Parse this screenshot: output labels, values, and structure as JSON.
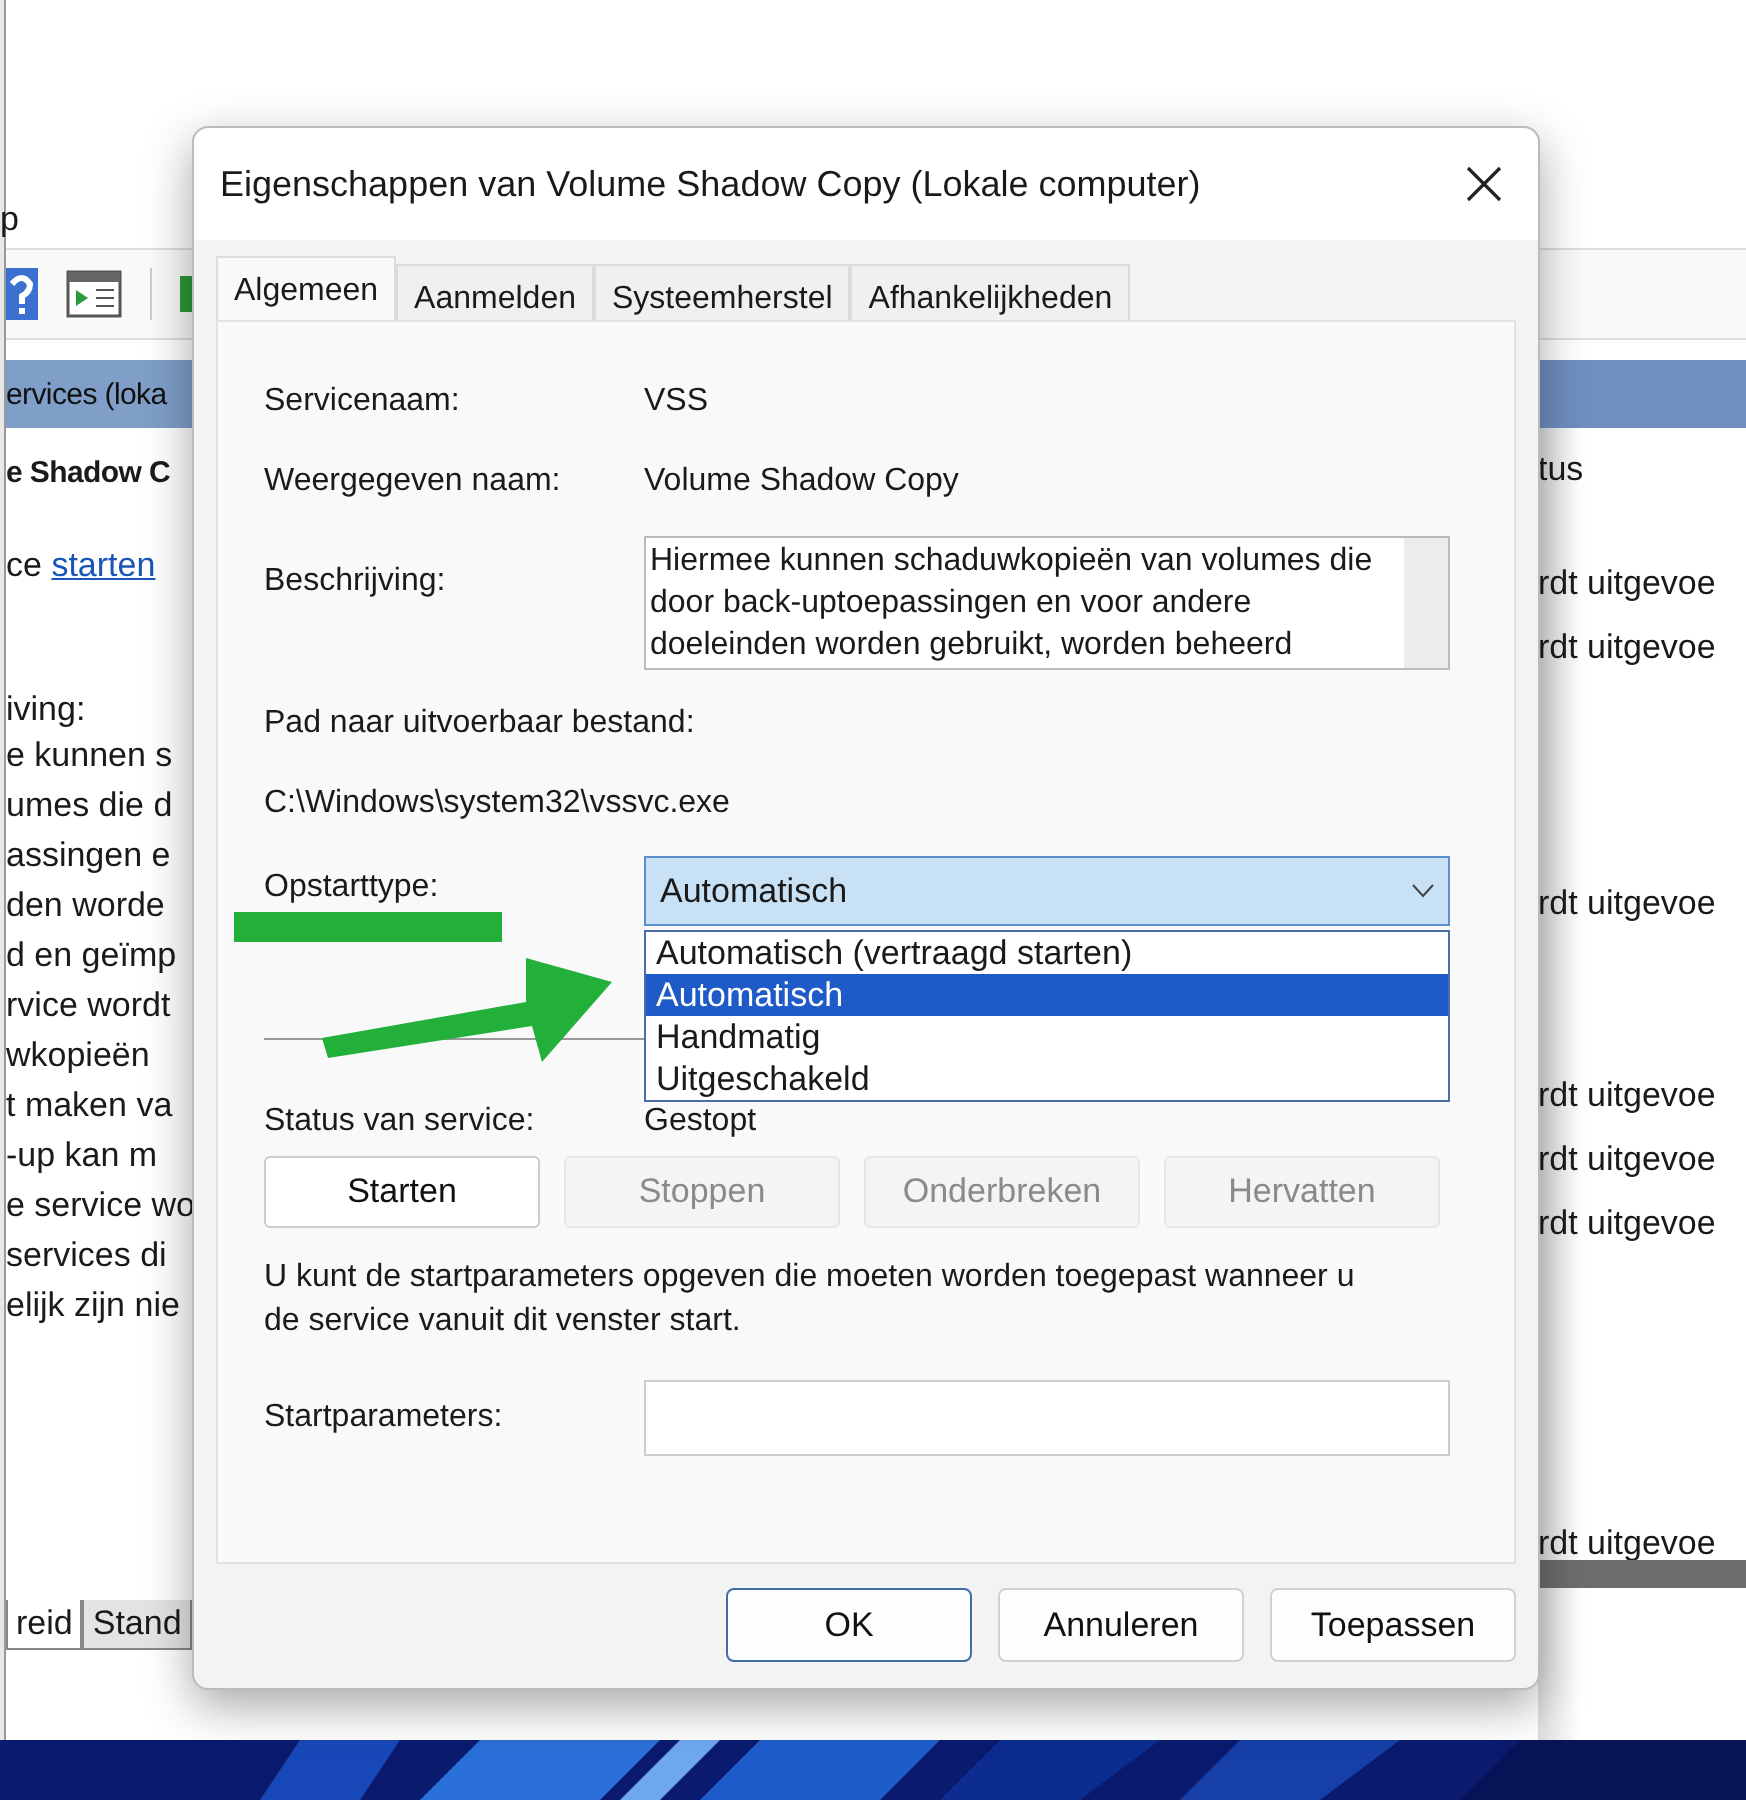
{
  "background_window": {
    "menu_text": "p",
    "header": "ervices (loka",
    "service_title": "e Shadow C",
    "action": {
      "prefix": "ce",
      "link": "starten"
    },
    "description_label": "iving:",
    "description_lines": [
      "e kunnen s",
      "umes die d",
      "assingen e",
      "den worde",
      "d en geïmp",
      "rvice wordt",
      "wkopieën",
      "t maken va",
      "-up kan m",
      "e service wo",
      "services di",
      "elijk zijn nie"
    ],
    "column_heading": "tus",
    "status_cells": [
      "rdt uitgevoe",
      "rdt uitgevoe",
      "rdt uitgevoe",
      "rdt uitgevoe",
      "rdt uitgevoe",
      "rdt uitgevoe",
      "rdt uitgevoe"
    ],
    "bottom_tabs": [
      {
        "label": "reid",
        "selected": true
      },
      {
        "label": "Stand",
        "selected": false
      }
    ]
  },
  "dialog": {
    "title": "Eigenschappen van Volume Shadow Copy (Lokale computer)",
    "tabs": [
      {
        "label": "Algemeen",
        "selected": true
      },
      {
        "label": "Aanmelden",
        "selected": false
      },
      {
        "label": "Systeemherstel",
        "selected": false
      },
      {
        "label": "Afhankelijkheden",
        "selected": false
      }
    ],
    "service_name": {
      "label": "Servicenaam:",
      "value": "VSS"
    },
    "display_name": {
      "label": "Weergegeven naam:",
      "value": "Volume Shadow Copy"
    },
    "description": {
      "label": "Beschrijving:",
      "value": "Hiermee kunnen schaduwkopieën van volumes die door back-uptoepassingen en voor andere doeleinden worden gebruikt, worden beheerd"
    },
    "path": {
      "label": "Pad naar uitvoerbaar bestand:",
      "value": "C:\\Windows\\system32\\vssvc.exe"
    },
    "startup_type": {
      "label": "Opstarttype:",
      "value": "Automatisch",
      "expanded": true,
      "options": [
        {
          "label": "Automatisch (vertraagd starten)",
          "selected": false
        },
        {
          "label": "Automatisch",
          "selected": true
        },
        {
          "label": "Handmatig",
          "selected": false
        },
        {
          "label": "Uitgeschakeld",
          "selected": false
        }
      ]
    },
    "status": {
      "label": "Status van service:",
      "value": "Gestopt"
    },
    "service_buttons": [
      {
        "label": "Starten",
        "disabled": false
      },
      {
        "label": "Stoppen",
        "disabled": true
      },
      {
        "label": "Onderbreken",
        "disabled": true
      },
      {
        "label": "Hervatten",
        "disabled": true
      }
    ],
    "hint": "U kunt de startparameters opgeven die moeten worden toegepast wanneer u de service vanuit dit venster start.",
    "start_parameters": {
      "label": "Startparameters:"
    },
    "footer_buttons": [
      {
        "label": "OK",
        "default": true
      },
      {
        "label": "Annuleren",
        "default": false
      },
      {
        "label": "Toepassen",
        "default": false
      }
    ]
  }
}
